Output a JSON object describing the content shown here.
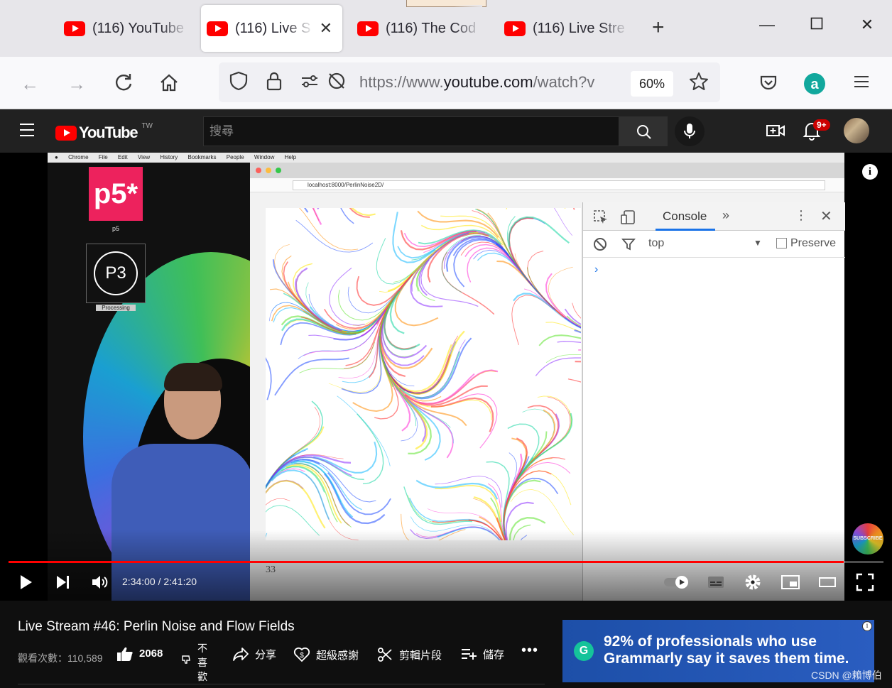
{
  "browser": {
    "tabs": [
      {
        "title": "(116) YouTube",
        "active": false
      },
      {
        "title": "(116) Live S",
        "active": true
      },
      {
        "title": "(116) The Cod",
        "active": false
      },
      {
        "title": "(116) Live Stre",
        "active": false
      }
    ],
    "url_prefix": "https://www.",
    "url_domain": "youtube.com",
    "url_suffix": "/watch?v",
    "zoom": "60%"
  },
  "youtube": {
    "brand": "YouTube",
    "region": "TW",
    "search_placeholder": "搜尋",
    "notification_count": "9+"
  },
  "video": {
    "current_time": "2:34:00",
    "duration": "2:41:20",
    "time_display": "2:34:00 / 2:41:20",
    "progress_fraction": 0.9546,
    "overlay": {
      "p5_label": "p5",
      "p5_logo": "p5*",
      "processing_label": "Processing",
      "mac_menu": [
        "Chrome",
        "File",
        "Edit",
        "View",
        "History",
        "Bookmarks",
        "People",
        "Window",
        "Help"
      ],
      "page_url": "localhost:8000/PerlinNoise2D/",
      "devtools_tab": "Console",
      "devtools_context": "top",
      "devtools_preserve": "Preserve",
      "frame_count": "33",
      "subscribe_label": "SUBSCRIBE"
    }
  },
  "meta": {
    "title": "Live Stream #46: Perlin Noise and Flow Fields",
    "views": "觀看次數：110,589",
    "likes": "2068",
    "dislike_label": "不喜歡",
    "actions": {
      "share": "分享",
      "thanks": "超級感謝",
      "clip": "剪輯片段",
      "save": "儲存"
    }
  },
  "ad": {
    "logo": "G",
    "line1": "92% of professionals who use",
    "line2": "Grammarly say it saves them time."
  },
  "watermark": "CSDN @賴博伯"
}
